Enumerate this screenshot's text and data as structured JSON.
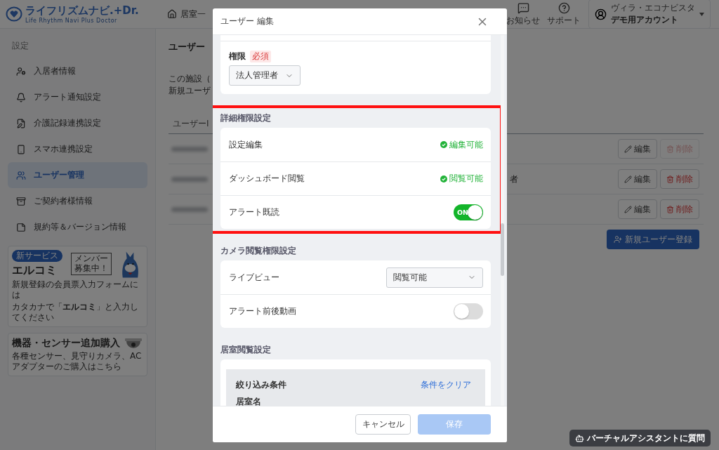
{
  "header": {
    "logo": {
      "name": "ライフリズムナビ.+Dr.",
      "tagline": "Life Rhythm Navi Plus Doctor"
    },
    "nav_link": "居室一",
    "icons": [
      {
        "kind": "chat",
        "label": "お知らせ"
      },
      {
        "kind": "help",
        "label": "サポート"
      }
    ],
    "account": {
      "facility": "ヴィラ・エコナビスタ",
      "name": "デモ用アカウント"
    }
  },
  "sidebar": {
    "heading": "設定",
    "items": [
      {
        "label": "入居者情報",
        "selected": false
      },
      {
        "label": "アラート通知設定",
        "selected": false
      },
      {
        "label": "介護記録連携設定",
        "selected": false
      },
      {
        "label": "スマホ連携設定",
        "selected": false
      },
      {
        "label": "ユーザー管理",
        "selected": true
      },
      {
        "label": "ご契約者様情報",
        "selected": false
      },
      {
        "label": "規約等＆バージョン情報",
        "selected": false
      }
    ],
    "banners": [
      {
        "kind": "service",
        "badge": "新サービス",
        "title": "エルコミ",
        "lines": [
          "新規登録の会員票入力フォームには",
          "カタカナで「**エルコミ**」と入力してください"
        ],
        "sign": "メンバー募集中！"
      },
      {
        "kind": "purchase",
        "title": "機器・センサー追加購入",
        "caption": "各種センサー、見守りカメラ、ACアダプターのご購入はこちら"
      }
    ]
  },
  "main": {
    "title": "ユーザー",
    "description": [
      "この施設（",
      "新規ユーザ"
    ],
    "table": {
      "columns": [
        "ユーザーI"
      ],
      "rows": [
        {
          "edit": "編集",
          "delete": "削除",
          "delete_disabled": true
        },
        {
          "column_3": "者",
          "edit": "編集",
          "delete": "削除",
          "delete_disabled": false
        },
        {
          "edit": "編集",
          "delete": "削除",
          "delete_disabled": false
        }
      ]
    },
    "add_button": "新規ユーザー登録"
  },
  "modal": {
    "title": "ユーザー 編集",
    "role_field": {
      "label": "権限",
      "badge": "必須",
      "value": "法人管理者"
    },
    "sections": [
      {
        "title": "詳細権限設定",
        "highlighted": true,
        "rows": [
          {
            "kind": "status",
            "label": "設定編集",
            "status": "編集可能"
          },
          {
            "kind": "status",
            "label": "ダッシュボード閲覧",
            "status": "閲覧可能"
          },
          {
            "kind": "toggle",
            "label": "アラート既読",
            "on": true,
            "on_label": "ON"
          }
        ]
      },
      {
        "title": "カメラ閲覧権限設定",
        "highlighted": false,
        "rows": [
          {
            "kind": "select",
            "label": "ライブビュー",
            "value": "閲覧可能"
          },
          {
            "kind": "toggle",
            "label": "アラート前後動画",
            "on": false
          }
        ]
      },
      {
        "title": "居室閲覧設定",
        "highlighted": false,
        "filter": {
          "title": "絞り込み条件",
          "clear": "条件をクリア",
          "field_label": "居室名"
        }
      }
    ],
    "buttons": [
      {
        "kind": "secondary",
        "label": "キャンセル",
        "disabled": false
      },
      {
        "kind": "primary",
        "label": "保存",
        "disabled": true
      }
    ]
  },
  "assistant": {
    "label": "バーチャルアシスタントに質問"
  }
}
